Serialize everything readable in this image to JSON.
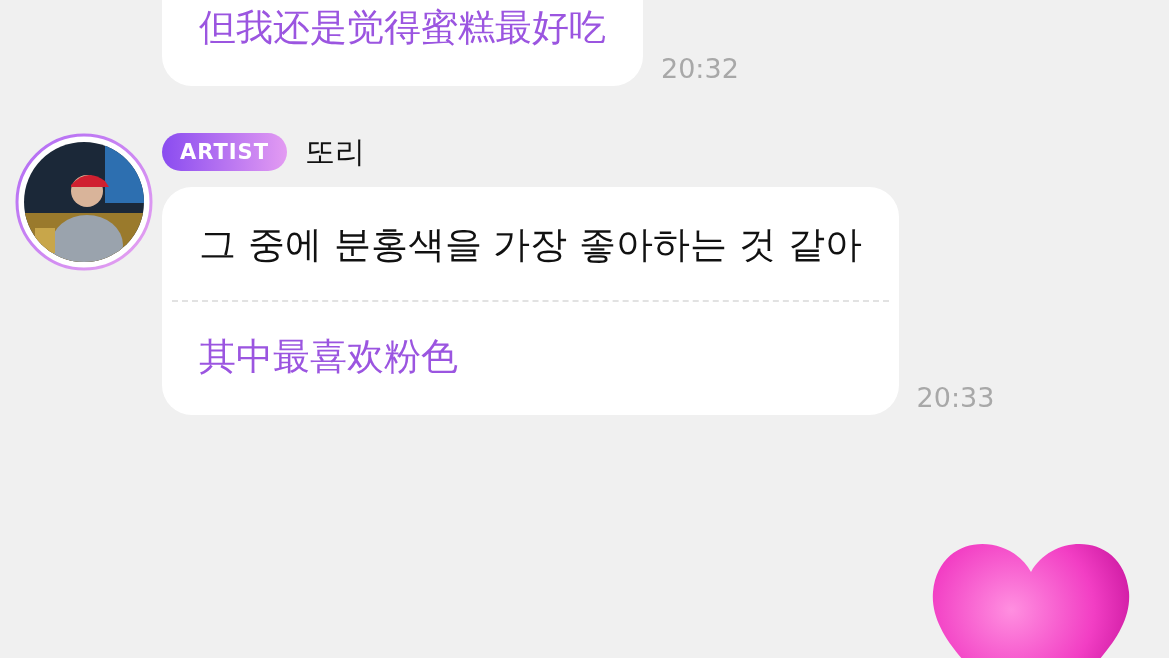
{
  "messages": [
    {
      "kind": "plain",
      "lines": [
        {
          "kind": "translation",
          "text": "但我还是觉得蜜糕最好吃"
        }
      ],
      "time": "20:32"
    },
    {
      "kind": "artist",
      "badge": "ARTIST",
      "sender": "또리",
      "lines": [
        {
          "kind": "original",
          "text": "그 중에 분홍색을 가장 좋아하는 것 같아"
        },
        {
          "kind": "translation",
          "text": "其中最喜欢粉色"
        }
      ],
      "time": "20:33"
    }
  ],
  "sticker": {
    "kind": "heart"
  }
}
